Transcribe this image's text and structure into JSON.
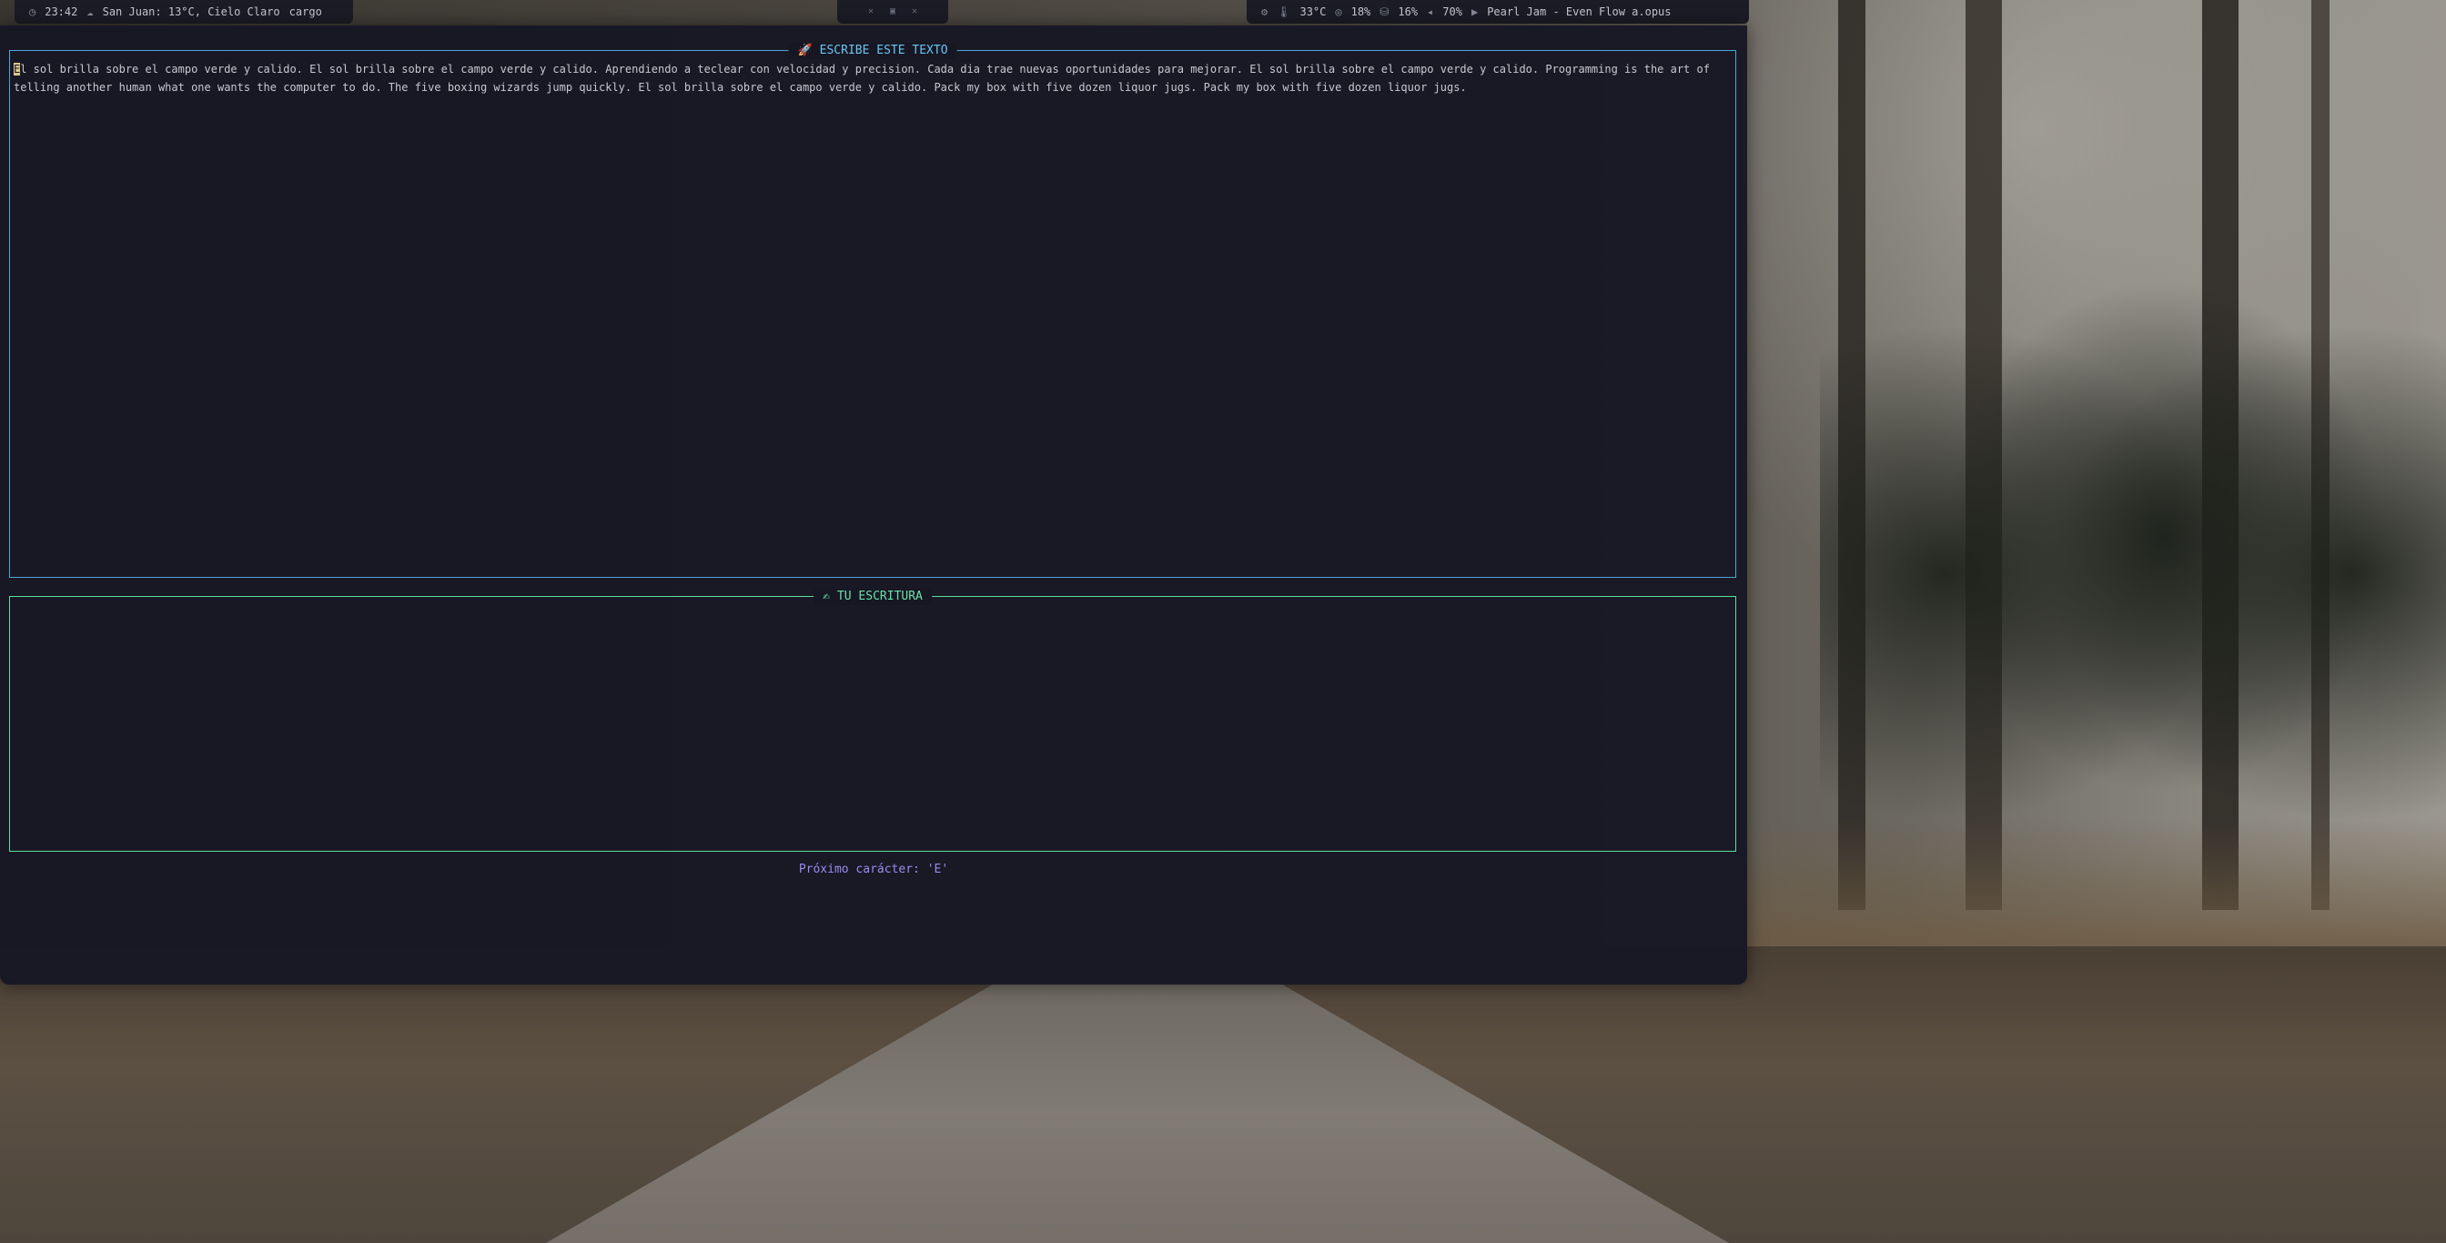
{
  "topbar": {
    "time": "23:42",
    "weather": "San Juan: 13°C, Cielo Claro",
    "app": "cargo",
    "cpu_temp": "33°C",
    "cpu": "18%",
    "mem": "16%",
    "volume": "70%",
    "media": "Pearl Jam - Even Flow a.opus"
  },
  "target_panel": {
    "title": "ESCRIBE ESTE TEXTO",
    "cursor_char": "E",
    "text_rest": "l sol brilla sobre el campo verde y calido. El sol brilla sobre el campo verde y calido. Aprendiendo a teclear con velocidad y precision. Cada dia trae nuevas oportunidades para mejorar. El sol brilla sobre el campo verde y calido. Programming is the art of telling another human what one wants the computer to do. The five boxing wizards jump quickly. El sol brilla sobre el campo verde y calido. Pack my box with five dozen liquor jugs. Pack my box with five dozen liquor jugs."
  },
  "writing_panel": {
    "title": "TU ESCRITURA",
    "content": ""
  },
  "hint": "Próximo carácter: 'E'",
  "icons": {
    "clock": "clock-icon",
    "weather": "cloud-icon",
    "temp": "thermometer-icon",
    "cpu": "cpu-icon",
    "mem": "memory-icon",
    "volume": "speaker-icon",
    "media": "play-icon",
    "target": "rocket-icon",
    "writing": "writing-hand-icon"
  },
  "colors": {
    "target_border": "#4ea6d8",
    "writing_border": "#5fdca0",
    "hint": "#9a8cf0",
    "window_bg": "#171724"
  }
}
